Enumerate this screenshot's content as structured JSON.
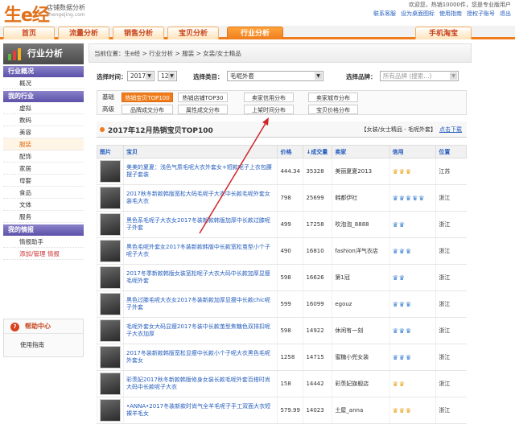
{
  "header": {
    "logo": "生e经",
    "logo_sub1": "店铺数据分析",
    "logo_sub2": "shengejing.com",
    "welcome": "欢迎您，热销10000件，您是专业版用户",
    "links": [
      "联系客服",
      "设为桌面图标",
      "使用指南",
      "授权子账号",
      "退出"
    ]
  },
  "nav": {
    "tabs": [
      "首页",
      "流量分析",
      "销售分析",
      "宝贝分析",
      "行业分析"
    ],
    "right_tab": "手机淘宝"
  },
  "sidebar": {
    "title": "行业分析",
    "groups": [
      {
        "head": "行业概况",
        "items": [
          "概况"
        ]
      },
      {
        "head": "我的行业",
        "items": [
          "虚拟",
          "数码",
          "美容",
          "服装",
          "配饰",
          "家居",
          "母婴",
          "食品",
          "文体",
          "服务"
        ]
      },
      {
        "head": "我的情报",
        "items": [
          "情报助手",
          "添加/管理 情报"
        ]
      }
    ],
    "current": "服装",
    "help_title": "帮助中心",
    "help_item": "使用指南"
  },
  "main": {
    "breadcrumb": "当前位置：生e经 > 行业分析 > 服装 > 女装/女士精品",
    "filter": {
      "time_label": "选择时间：",
      "year": "2017",
      "month": "12",
      "cat_label": "选择类目：",
      "cat": "毛呢外套",
      "brand_label": "选择品牌：",
      "brand_placeholder": "所有品牌 (搜索...)"
    },
    "tabs": {
      "row1_label": "基础",
      "row1": [
        "热销宝贝TOP100",
        "热销店铺TOP30",
        "卖家信用分布",
        "卖家城市分布"
      ],
      "row2_label": "高级",
      "row2": [
        "品牌成交分布",
        "属性成交分布",
        "上架时间分布",
        "宝贝价格分布"
      ],
      "active": "热销宝贝TOP100"
    },
    "section": {
      "title": "2017年12月热销宝贝TOP100",
      "scope": "【女装/女士精品 - 毛呢外套】",
      "download": "点击下载"
    },
    "table": {
      "headers": [
        "图片",
        "宝贝",
        "价格",
        "↓成交量",
        "卖家",
        "信用",
        "位置"
      ],
      "rows": [
        {
          "title": "美美的夏夏：浅色气质毛呢大衣外套女+短款呢子上衣包腰摆子套装",
          "price": "444.34",
          "volume": "35328",
          "seller": "美丽夏夏2013",
          "credit": "♛♛♛",
          "credit_color": "gold",
          "loc": "江苏"
        },
        {
          "title": "2017秋冬新款韩版宽松大码毛呢子大衣中长款毛呢外套女装毛大衣",
          "price": "798",
          "volume": "25699",
          "seller": "韩都伊社",
          "credit": "♛♛♛♛♛",
          "credit_color": "blue",
          "loc": "浙江"
        },
        {
          "title": "黑色系毛呢子大衣女2017冬装新款韩版加厚中长款过膝呢子外套",
          "price": "499",
          "volume": "17258",
          "seller": "吹泡泡_8888",
          "credit": "♛♛",
          "credit_color": "blue",
          "loc": "浙江"
        },
        {
          "title": "黑色毛呢外套女2017冬装新款韩版中长款宽松茧型小个子呢子大衣",
          "price": "490",
          "volume": "16810",
          "seller": "fashion洋气衣店",
          "credit": "♛♛♛",
          "credit_color": "blue",
          "loc": "浙江"
        },
        {
          "title": "2017冬季新款韩版女装宽松呢子大衣大码中长款加厚显瘦毛呢外套",
          "price": "598",
          "volume": "16626",
          "seller": "第1冠",
          "credit": "♛♛",
          "credit_color": "blue",
          "loc": "浙江"
        },
        {
          "title": "黑色过膝毛呢大衣女2017冬装新款加厚显瘦中长款chic呢子外套",
          "price": "599",
          "volume": "16099",
          "seller": "egouz",
          "credit": "♛♛♛",
          "credit_color": "blue",
          "loc": "浙江"
        },
        {
          "title": "毛呢外套女大码显瘦2017冬装中长款茧型焦糖色双排扣呢子大衣加厚",
          "price": "598",
          "volume": "14922",
          "seller": "休闲有一刻",
          "credit": "♛♛♛",
          "credit_color": "blue",
          "loc": "浙江"
        },
        {
          "title": "2017冬装新款韩版宽松显瘦中长款小个子呢大衣黑色毛呢外套女",
          "price": "1258",
          "volume": "14715",
          "seller": "蜜糖小兜女装",
          "credit": "♛♛♛",
          "credit_color": "blue",
          "loc": "浙江"
        },
        {
          "title": "彩羡妃2017秋冬新款韩版修身女装长款毛呢外套百搭时尚大码中长款呢子大衣",
          "price": "158",
          "volume": "14442",
          "seller": "彩羡妃旗舰店",
          "credit": "♛♛",
          "credit_color": "gold",
          "loc": "浙江"
        },
        {
          "title": "•ANNA•2017冬装新款时尚气全羊毛呢子手工双面大衣短裸羊毛女",
          "price": "579.99",
          "volume": "14023",
          "seller": "土屋_anna",
          "credit": "♛♛♛",
          "credit_color": "gold",
          "loc": "浙江"
        }
      ]
    }
  }
}
